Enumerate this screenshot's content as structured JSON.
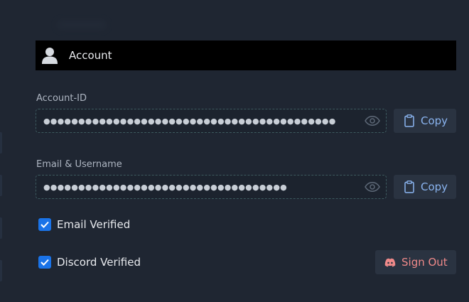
{
  "header": {
    "title": "Account",
    "icon": "user-icon"
  },
  "account_id": {
    "label": "Account-ID",
    "masked_value": "●●●●●●●●●●●●●●●●●●●●●●●●●●●●●●●●●●●●●●●●●●",
    "copy_label": "Copy"
  },
  "email": {
    "label": "Email & Username",
    "masked_value": "●●●●●●●●●●●●●●●●●●●●●●●●●●●●●●●●●●●",
    "copy_label": "Copy"
  },
  "verification": {
    "email_verified": {
      "label": "Email Verified",
      "checked": true
    },
    "discord_verified": {
      "label": "Discord Verified",
      "checked": true
    }
  },
  "sign_out": {
    "label": "Sign Out",
    "icon": "discord-icon"
  },
  "colors": {
    "background": "#1f2632",
    "header_bg": "#000000",
    "accent_blue": "#1a73e8",
    "copy_text": "#8ab4f0",
    "signout_text": "#f08a8a",
    "button_bg": "#2a3341"
  }
}
